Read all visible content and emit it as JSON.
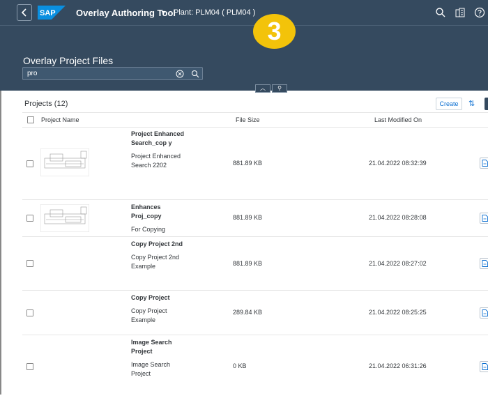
{
  "shell": {
    "app_title": "Overlay Authoring Tool",
    "plant": "Plant: PLM04 ( PLM04 )",
    "logo_text": "SAP"
  },
  "header": {
    "page_title": "Overlay Project Files",
    "step_badge": "3"
  },
  "search": {
    "value": "pro"
  },
  "table": {
    "title": "Projects (12)",
    "create_label": "Create",
    "columns": [
      "Project Name",
      "File Size",
      "Last Modified On"
    ],
    "rows": [
      {
        "title": "Project Enhanced Search_cop y",
        "desc": "Project Enhanced Search 2202",
        "size": "881.89 KB",
        "modified": "21.04.2022 08:32:39",
        "has_thumb": true
      },
      {
        "title": "Enhances Proj_copy",
        "desc": "For Copying",
        "size": "881.89 KB",
        "modified": "21.04.2022 08:28:08",
        "has_thumb": true
      },
      {
        "title": "Copy Project 2nd",
        "desc": "Copy Project 2nd Example",
        "size": "881.89 KB",
        "modified": "21.04.2022 08:27:02",
        "has_thumb": false
      },
      {
        "title": "Copy Project",
        "desc": "Copy Project Example",
        "size": "289.84 KB",
        "modified": "21.04.2022 08:25:25",
        "has_thumb": false
      },
      {
        "title": "Image Search Project",
        "desc": "Image Search Project",
        "size": "0 KB",
        "modified": "21.04.2022 06:31:26",
        "has_thumb": false
      }
    ]
  },
  "colors": {
    "shell_bg": "#354a5f",
    "accent": "#0a6ed1",
    "badge": "#f3c30a"
  }
}
